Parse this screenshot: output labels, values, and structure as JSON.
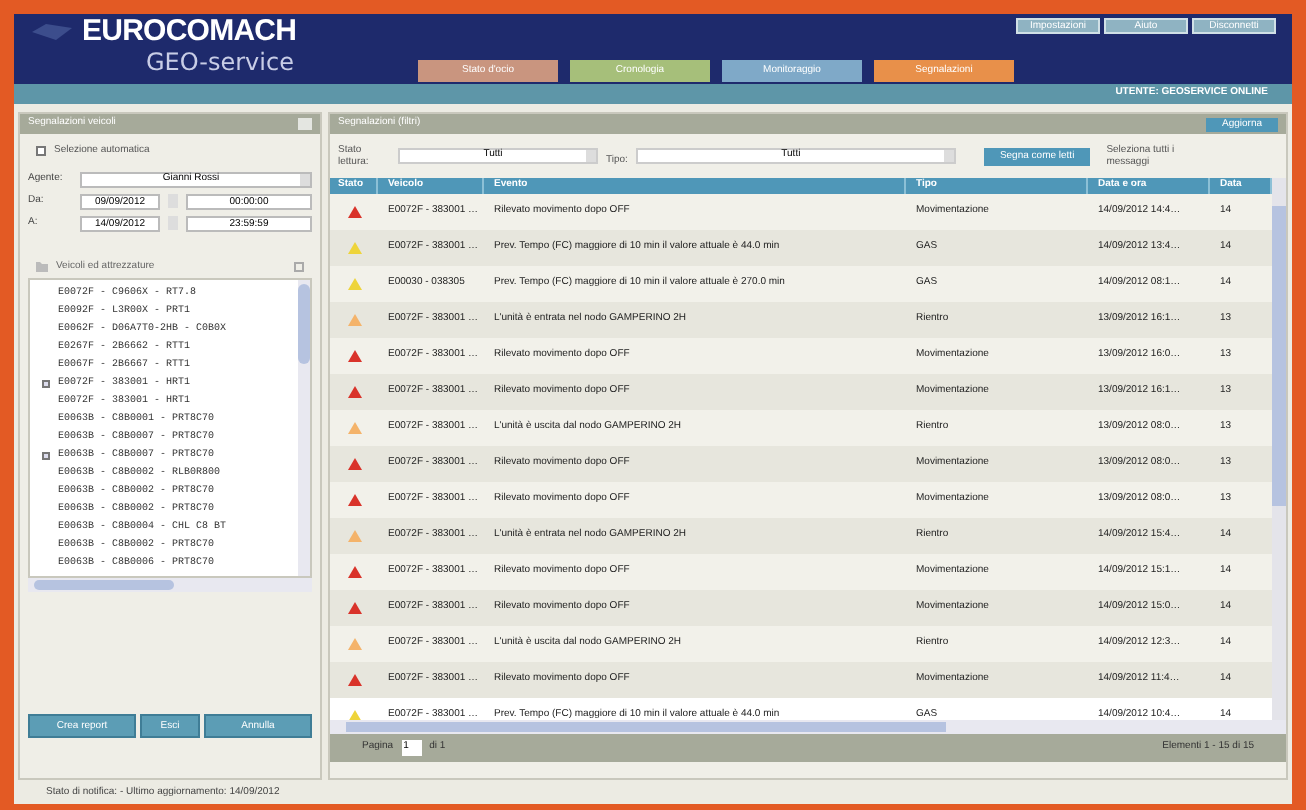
{
  "header": {
    "logo_title": "EUROCOMACH",
    "logo_subtitle": "GEO-service",
    "nav_tabs": [
      {
        "label": "Stato d'ocio",
        "color": "#c9957f"
      },
      {
        "label": "Cronologia",
        "color": "#a6bf7a"
      },
      {
        "label": "Monitoraggio",
        "color": "#7fa9c8"
      },
      {
        "label": "Segnalazioni",
        "color": "#e8904a"
      }
    ],
    "top_links": [
      "Impostazioni",
      "Aiuto",
      "Disconnetti"
    ],
    "user_info": "UTENTE: GEOSERVICE ONLINE"
  },
  "left_panel": {
    "title": "Segnalazioni veicoli",
    "auto_select": {
      "label": "Selezione automatica",
      "checked": false
    },
    "agent": {
      "label": "Agente:",
      "value": "Gianni Rossi"
    },
    "from": {
      "label": "Da:",
      "date": "09/09/2012",
      "time": "00:00:00"
    },
    "to": {
      "label": "A:",
      "date": "14/09/2012",
      "time": "23:59:59"
    },
    "tree": {
      "title": "Veicoli ed attrezzature",
      "items": [
        {
          "label": "E0072F - C9606X - RT7.8",
          "checked": false
        },
        {
          "label": "E0092F - L3R00X - PRT1",
          "checked": false
        },
        {
          "label": "E0062F - D06A7T0-2HB - C0B0X",
          "checked": false
        },
        {
          "label": "E0267F - 2B6662 - RTT1",
          "checked": false
        },
        {
          "label": "E0067F - 2B6667 - RTT1",
          "checked": false
        },
        {
          "label": "E0072F - 383001 - HRT1",
          "checked": true
        },
        {
          "label": "E0072F - 383001 - HRT1",
          "checked": false
        },
        {
          "label": "E0063B - C8B0001 - PRT8C70",
          "checked": false
        },
        {
          "label": "E0063B - C8B0007 - PRT8C70",
          "checked": false
        },
        {
          "label": "E0063B - C8B0007 - PRT8C70",
          "checked": true
        },
        {
          "label": "E0063B - C8B0002 - RLB0R800",
          "checked": false
        },
        {
          "label": "E0063B - C8B0002 - PRT8C70",
          "checked": false
        },
        {
          "label": "E0063B - C8B0002 - PRT8C70",
          "checked": false
        },
        {
          "label": "E0063B - C8B0004 - CHL C8 BT",
          "checked": false
        },
        {
          "label": "E0063B - C8B0002 - PRT8C70",
          "checked": false
        },
        {
          "label": "E0063B - C8B0006 - PRT8C70",
          "checked": false
        }
      ]
    },
    "buttons": [
      "Crea report",
      "Esci",
      "Annulla"
    ]
  },
  "right_panel": {
    "title": "Segnalazioni (filtri)",
    "refresh_button": "Aggiorna",
    "filters": {
      "read_label": "Stato lettura:",
      "read_value": "Tutti",
      "type_label": "Tipo:",
      "type_value": "Tutti",
      "mark_button": "Segna come letti",
      "select_all_label": "Seleziona tutti i messaggi"
    },
    "columns": [
      "Stato",
      "Veicolo",
      "Evento",
      "Tipo",
      "Data e ora",
      "Data"
    ],
    "rows": [
      {
        "kind": "alarm",
        "vehicle": "E0072F - 383001 …",
        "event": "Rilevato movimento dopo OFF",
        "type": "Movimentazione",
        "datetime": "14/09/2012 14:4…",
        "column_6": "14",
        "selected": false
      },
      {
        "kind": "warning",
        "vehicle": "E0072F - 383001 …",
        "event": "Prev. Tempo (FC) maggiore di 10 min il valore attuale è 44.0 min",
        "type": "GAS",
        "datetime": "14/09/2012 13:4…",
        "column_6": "14",
        "selected": false
      },
      {
        "kind": "warning",
        "vehicle": "E00030 - 038305",
        "event": "Prev. Tempo (FC) maggiore di 10 min il valore attuale è 270.0 min",
        "type": "GAS",
        "datetime": "14/09/2012 08:1…",
        "column_6": "14",
        "selected": false
      },
      {
        "kind": "info",
        "vehicle": "E0072F - 383001 …",
        "event": "L'unità è entrata nel nodo GAMPERINO 2H",
        "type": "Rientro",
        "datetime": "13/09/2012 16:1…",
        "column_6": "13",
        "selected": false
      },
      {
        "kind": "alarm",
        "vehicle": "E0072F - 383001 …",
        "event": "Rilevato movimento dopo OFF",
        "type": "Movimentazione",
        "datetime": "13/09/2012 16:0…",
        "column_6": "13",
        "selected": false
      },
      {
        "kind": "alarm",
        "vehicle": "E0072F - 383001 …",
        "event": "Rilevato movimento dopo OFF",
        "type": "Movimentazione",
        "datetime": "13/09/2012 16:1…",
        "column_6": "13",
        "selected": false
      },
      {
        "kind": "info",
        "vehicle": "E0072F - 383001 …",
        "event": "L'unità è uscita dal nodo GAMPERINO 2H",
        "type": "Rientro",
        "datetime": "13/09/2012 08:0…",
        "column_6": "13",
        "selected": false
      },
      {
        "kind": "alarm",
        "vehicle": "E0072F - 383001 …",
        "event": "Rilevato movimento dopo OFF",
        "type": "Movimentazione",
        "datetime": "13/09/2012 08:0…",
        "column_6": "13",
        "selected": false
      },
      {
        "kind": "alarm",
        "vehicle": "E0072F - 383001 …",
        "event": "Rilevato movimento dopo OFF",
        "type": "Movimentazione",
        "datetime": "13/09/2012 08:0…",
        "column_6": "13",
        "selected": false
      },
      {
        "kind": "info",
        "vehicle": "E0072F - 383001 …",
        "event": "L'unità è entrata nel nodo GAMPERINO 2H",
        "type": "Rientro",
        "datetime": "14/09/2012 15:4…",
        "column_6": "14",
        "selected": false
      },
      {
        "kind": "alarm",
        "vehicle": "E0072F - 383001 …",
        "event": "Rilevato movimento dopo OFF",
        "type": "Movimentazione",
        "datetime": "14/09/2012 15:1…",
        "column_6": "14",
        "selected": false
      },
      {
        "kind": "alarm",
        "vehicle": "E0072F - 383001 …",
        "event": "Rilevato movimento dopo OFF",
        "type": "Movimentazione",
        "datetime": "14/09/2012 15:0…",
        "column_6": "14",
        "selected": false
      },
      {
        "kind": "info",
        "vehicle": "E0072F - 383001 …",
        "event": "L'unità è uscita dal nodo GAMPERINO 2H",
        "type": "Rientro",
        "datetime": "14/09/2012 12:3…",
        "column_6": "14",
        "selected": false
      },
      {
        "kind": "alarm",
        "vehicle": "E0072F - 383001 …",
        "event": "Rilevato movimento dopo OFF",
        "type": "Movimentazione",
        "datetime": "14/09/2012 11:4…",
        "column_6": "14",
        "selected": false
      },
      {
        "kind": "warning",
        "vehicle": "E0072F - 383001 …",
        "event": "Prev. Tempo (FC) maggiore di 10 min il valore attuale è 44.0 min",
        "type": "GAS",
        "datetime": "14/09/2012 10:4…",
        "column_6": "14",
        "selected": true
      }
    ],
    "pager": {
      "page_label": "Pagina",
      "page_value": "1",
      "of_label": "di 1",
      "summary": "Elementi 1 - 15 di 15"
    }
  },
  "status_bar": "Stato di notifica: - Ultimo aggiornamento: 14/09/2012"
}
